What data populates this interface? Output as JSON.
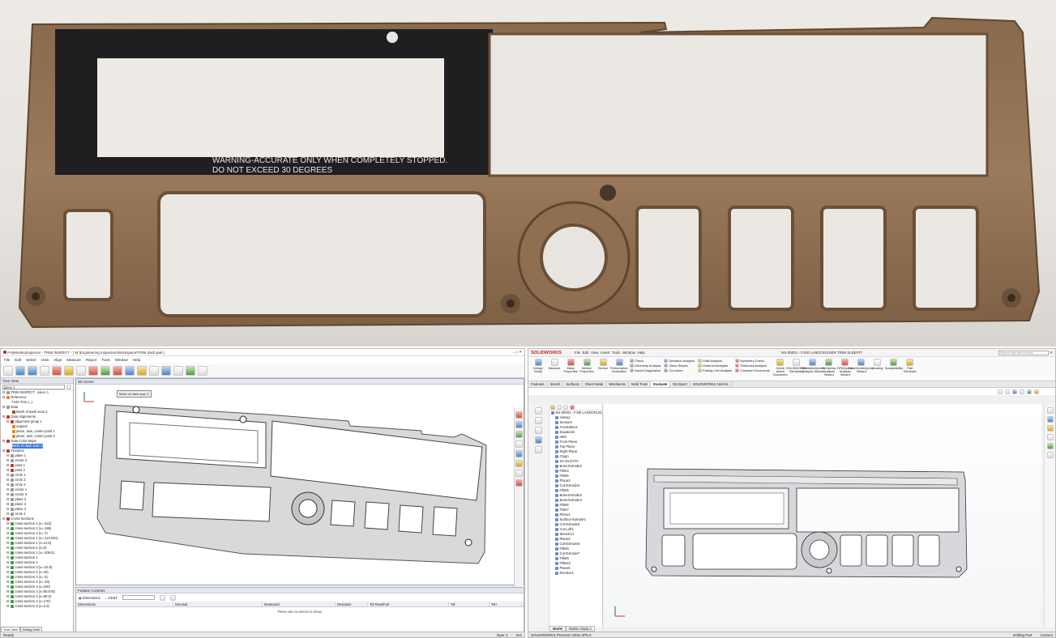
{
  "photo": {
    "warning_line1": "WARNING-ACCURATE ONLY WHEN COMPLETELY STOPPED.",
    "warning_line2": "DO NOT EXCEED 30 DEGREES"
  },
  "polyworks": {
    "title": "PolyWorks|Inspector - TRIM INSPECT - [ M:\\Engineering Inspection\\Workspace\\TRIM dash.pwk ]",
    "menu": [
      "File",
      "Edit",
      "Select",
      "View",
      "Align",
      "Measure",
      "Report",
      "Tools",
      "Window",
      "Help"
    ],
    "tree_view_label": "Tree View",
    "tree_combo_value": "piece 1",
    "scene_label": "3D Scene",
    "mesh_label": "Mesh of dash scan 2",
    "tree": [
      {
        "t": "TRIM INSPECT - piece 1",
        "lvl": 0,
        "ic": "gry"
      },
      {
        "t": "Reference",
        "lvl": 0,
        "ic": "org"
      },
      {
        "t": "FJ40 Trim c_t",
        "lvl": 2,
        "ic": ""
      },
      {
        "t": "Data",
        "lvl": 0,
        "ic": "gry"
      },
      {
        "t": "Mesh of dash scan 2",
        "lvl": 2,
        "ic": "red"
      },
      {
        "t": "Data Alignments",
        "lvl": 0,
        "ic": "red"
      },
      {
        "t": "alignment group 1",
        "lvl": 1,
        "ic": "red"
      },
      {
        "t": "original",
        "lvl": 2,
        "ic": "org"
      },
      {
        "t": "plane, axis, center point 1",
        "lvl": 2,
        "ic": "org"
      },
      {
        "t": "plane, axis, center point 2",
        "lvl": 2,
        "ic": "org"
      },
      {
        "t": "Data Color Maps",
        "lvl": 0,
        "ic": "red"
      },
      {
        "t": "Mesh of dash scan 2",
        "lvl": 2,
        "ic": "",
        "sel": true
      },
      {
        "t": "Features",
        "lvl": 0,
        "ic": "red"
      },
      {
        "t": "plane 1",
        "lvl": 1,
        "ic": "gry"
      },
      {
        "t": "vector 2",
        "lvl": 1,
        "ic": "gry"
      },
      {
        "t": "point 1",
        "lvl": 1,
        "ic": "red"
      },
      {
        "t": "point 2",
        "lvl": 1,
        "ic": "red"
      },
      {
        "t": "circle 1",
        "lvl": 1,
        "ic": "gry"
      },
      {
        "t": "circle 2",
        "lvl": 1,
        "ic": "gry"
      },
      {
        "t": "circle 3",
        "lvl": 1,
        "ic": "gry"
      },
      {
        "t": "vector 1",
        "lvl": 1,
        "ic": "gry"
      },
      {
        "t": "vector 3",
        "lvl": 1,
        "ic": "gry"
      },
      {
        "t": "plane 2",
        "lvl": 1,
        "ic": "gry"
      },
      {
        "t": "plane 3",
        "lvl": 1,
        "ic": "gry"
      },
      {
        "t": "plane 4",
        "lvl": 1,
        "ic": "gry"
      },
      {
        "t": "circle 4",
        "lvl": 1,
        "ic": "gry"
      },
      {
        "t": "Cross-Sections",
        "lvl": 0,
        "ic": "red"
      },
      {
        "t": "cross-section 1 (x=-222)",
        "lvl": 1,
        "ic": "grn"
      },
      {
        "t": "cross-section 2 (x=-196)",
        "lvl": 1,
        "ic": "grn"
      },
      {
        "t": "cross-section 3 (x=-7)",
        "lvl": 1,
        "ic": "grn"
      },
      {
        "t": "cross-section 1 (x=-124.061)",
        "lvl": 1,
        "ic": "grn"
      },
      {
        "t": "cross-section 1 (z=12.5)",
        "lvl": 1,
        "ic": "grn"
      },
      {
        "t": "cross-section 2 (z=0)",
        "lvl": 1,
        "ic": "grn"
      },
      {
        "t": "cross-section 1 (x=-206.5)",
        "lvl": 1,
        "ic": "grn"
      },
      {
        "t": "cross-section 1",
        "lvl": 1,
        "ic": "grn"
      },
      {
        "t": "cross-section 2",
        "lvl": 1,
        "ic": "grn"
      },
      {
        "t": "cross-section 3 (x=-34.8)",
        "lvl": 1,
        "ic": "grn"
      },
      {
        "t": "cross-section 3 (x=40)",
        "lvl": 1,
        "ic": "grn"
      },
      {
        "t": "cross-section 3 (x=-3)",
        "lvl": 1,
        "ic": "grn"
      },
      {
        "t": "cross-section 4 (x=-18)",
        "lvl": 1,
        "ic": "grn"
      },
      {
        "t": "cross-section 3 (x=100)",
        "lvl": 1,
        "ic": "grn"
      },
      {
        "t": "cross-section 3 (x=90.578)",
        "lvl": 1,
        "ic": "grn"
      },
      {
        "t": "cross-section 3 (x=80.3)",
        "lvl": 1,
        "ic": "grn"
      },
      {
        "t": "cross-section 3 (x=170)",
        "lvl": 1,
        "ic": "grn"
      },
      {
        "t": "cross-section 3 (x=3.3)",
        "lvl": 1,
        "ic": "grn"
      }
    ],
    "tree_tabs": [
      "Tree View",
      "Dialog Zone"
    ],
    "features_panel": {
      "label": "Feature Controls",
      "option_dimensions": "Dimensions",
      "option_gdt": "GD&T",
      "columns": [
        "Dimensions",
        "Nominal",
        "Measured",
        "Deviation",
        "Tol Pass/Fail",
        "Tol-",
        "Tol+"
      ],
      "empty": "There are no items to show."
    },
    "status": {
      "left": "Ready",
      "right1": "layer 1",
      "right2": "mm"
    }
  },
  "solidworks": {
    "brand": "SOLIDWORKS",
    "menu": [
      "File",
      "Edit",
      "View",
      "Insert",
      "Tools",
      "Window",
      "Help"
    ],
    "doc_title": "M1-00001 - FJ40 LANDCRUISER TRIM SLEEPIT",
    "search_placeholder": "Search files and models",
    "ribbon_big": [
      {
        "l": "Design Study"
      },
      {
        "l": "Measure"
      },
      {
        "l": "Mass Properties"
      },
      {
        "l": "Section Properties"
      },
      {
        "l": "Sensor"
      },
      {
        "l": "Performance Evaluation"
      }
    ],
    "ribbon_small1": [
      "Check",
      "Geometry Analysis",
      "Import Diagnostics"
    ],
    "ribbon_small2": [
      "Deviation Analysis",
      "Zebra Stripes",
      "Curvature"
    ],
    "ribbon_small3": [
      "Draft Analysis",
      "Undercut Analysis",
      "Parting Line Analysis"
    ],
    "ribbon_small4": [
      "Symmetry Check",
      "Thickness Analysis",
      "Compare Documents"
    ],
    "ribbon_big2": [
      {
        "l": "Check Active Document"
      },
      {
        "l": "SOLIDWORKS Simulation"
      },
      {
        "l": "SimulationXpress Analysis Wizard"
      },
      {
        "l": "FloXpress Analysis Wizard"
      },
      {
        "l": "DFMXpress Analysis Wizard"
      },
      {
        "l": "DriveWorksXpress Wizard"
      },
      {
        "l": "Costing"
      },
      {
        "l": "Sustainability"
      },
      {
        "l": "Part Reviewer"
      }
    ],
    "tabs": [
      "Features",
      "Sketch",
      "Surfaces",
      "Sheet Metal",
      "Weldments",
      "Mold Tools",
      "Evaluate",
      "DimXpert",
      "SOLIDWORKS Add-Ins"
    ],
    "active_tab": "Evaluate",
    "tree": [
      {
        "t": "M1-00001 - FJ40 LANDCRUISER",
        "lvl": 0
      },
      {
        "t": "History",
        "lvl": 1
      },
      {
        "t": "Sensors",
        "lvl": 1
      },
      {
        "t": "Annotations",
        "lvl": 1
      },
      {
        "t": "Equations",
        "lvl": 1
      },
      {
        "t": "ABS",
        "lvl": 1
      },
      {
        "t": "Front Plane",
        "lvl": 1
      },
      {
        "t": "Top Plane",
        "lvl": 1
      },
      {
        "t": "Right Plane",
        "lvl": 1
      },
      {
        "t": "Origin",
        "lvl": 1
      },
      {
        "t": "SCAN DATA",
        "lvl": 1
      },
      {
        "t": "Boss-Extrude2",
        "lvl": 1
      },
      {
        "t": "Fillet3",
        "lvl": 1
      },
      {
        "t": "Fillet5",
        "lvl": 1
      },
      {
        "t": "Plane3",
        "lvl": 1
      },
      {
        "t": "Cut-Extrude2",
        "lvl": 1
      },
      {
        "t": "Fillet5",
        "lvl": 1
      },
      {
        "t": "Boss-Extrude3",
        "lvl": 1
      },
      {
        "t": "Boss-Extrude4",
        "lvl": 1
      },
      {
        "t": "Fillet6",
        "lvl": 1
      },
      {
        "t": "Fillet7",
        "lvl": 1
      },
      {
        "t": "Plane4",
        "lvl": 1
      },
      {
        "t": "Surface-Extrude1",
        "lvl": 1
      },
      {
        "t": "Cut-Extrude5",
        "lvl": 1
      },
      {
        "t": "Cut-Loft1",
        "lvl": 1
      },
      {
        "t": "Sketch14",
        "lvl": 1
      },
      {
        "t": "Plane5",
        "lvl": 1
      },
      {
        "t": "Cut-Extrude6",
        "lvl": 1
      },
      {
        "t": "Fillet8",
        "lvl": 1
      },
      {
        "t": "Cut-Extrude7",
        "lvl": 1
      },
      {
        "t": "Fillet9",
        "lvl": 1
      },
      {
        "t": "Fillet10",
        "lvl": 1
      },
      {
        "t": "Plane6",
        "lvl": 1
      },
      {
        "t": "Revolve1",
        "lvl": 1
      }
    ],
    "bottom_tabs": [
      "Model",
      "Motion Study 1"
    ],
    "status": {
      "left": "SOLIDWORKS Premium 2016 SP5.0",
      "mid": "Editing Part",
      "right": "Custom"
    }
  }
}
